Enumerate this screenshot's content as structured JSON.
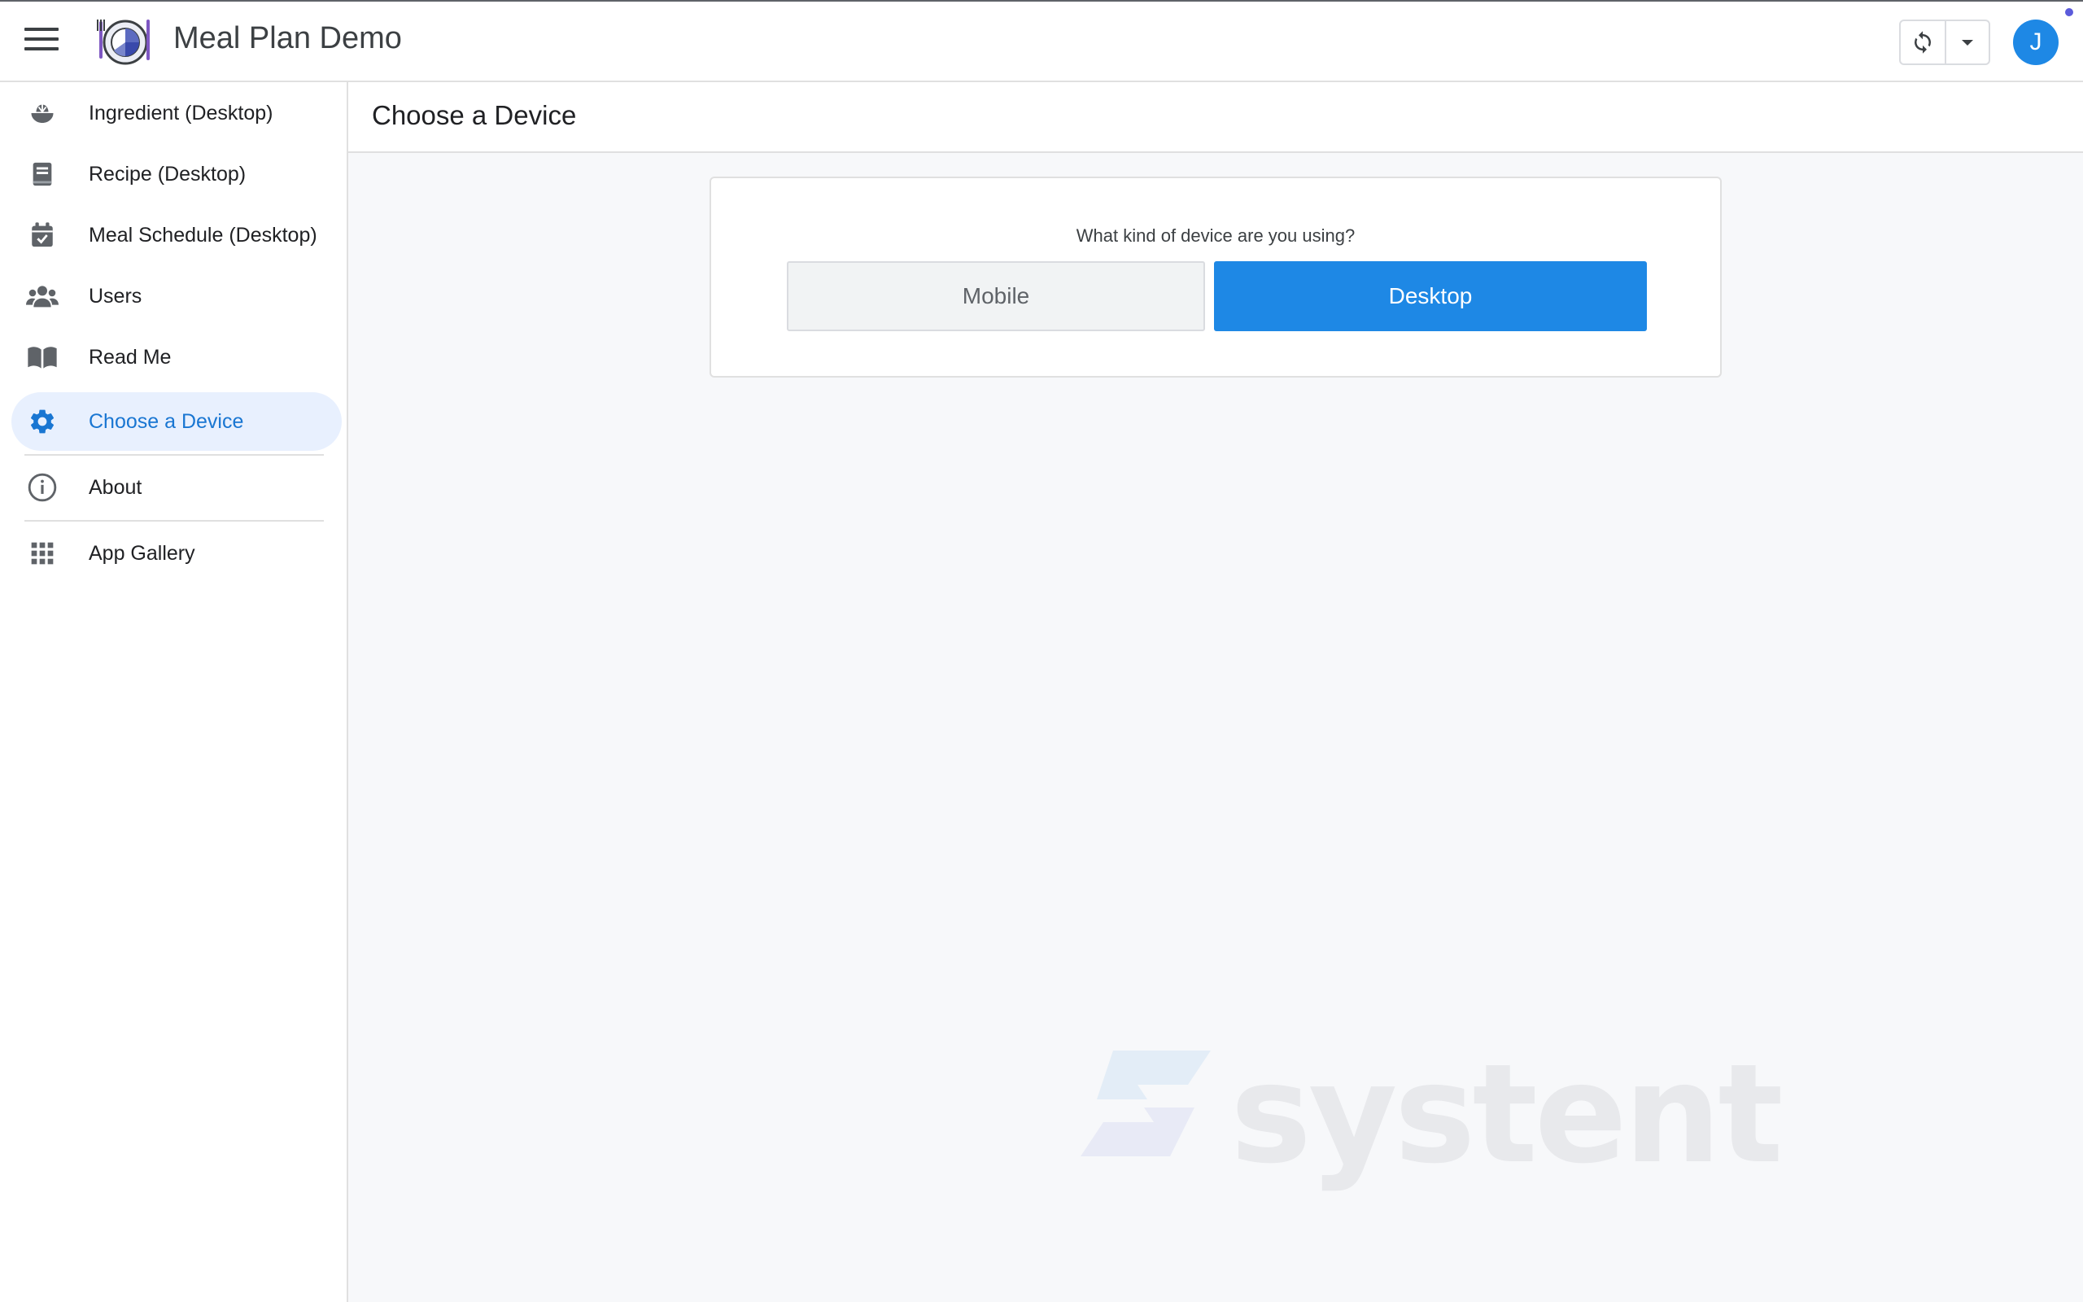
{
  "app": {
    "title": "Meal Plan Demo",
    "avatar_initial": "J",
    "accent_color": "#1e88e5"
  },
  "header": {
    "menu_icon": "hamburger-menu-icon",
    "sync_icon": "sync-icon",
    "dropdown_icon": "caret-down-icon"
  },
  "sidebar": {
    "items": [
      {
        "label": "Ingredient (Desktop)",
        "icon": "salad-bowl-icon"
      },
      {
        "label": "Recipe (Desktop)",
        "icon": "book-icon"
      },
      {
        "label": "Meal Schedule (Desktop)",
        "icon": "calendar-check-icon"
      },
      {
        "label": "Users",
        "icon": "users-icon"
      },
      {
        "label": "Read Me",
        "icon": "open-book-icon"
      },
      {
        "label": "Choose a Device",
        "icon": "gear-icon",
        "active": true
      },
      {
        "label": "About",
        "icon": "info-icon"
      },
      {
        "label": "App Gallery",
        "icon": "grid-icon"
      }
    ]
  },
  "main": {
    "page_title": "Choose a Device",
    "question": "What kind of device are you using?",
    "buttons": {
      "mobile": "Mobile",
      "desktop": "Desktop"
    },
    "watermark": "systent"
  }
}
